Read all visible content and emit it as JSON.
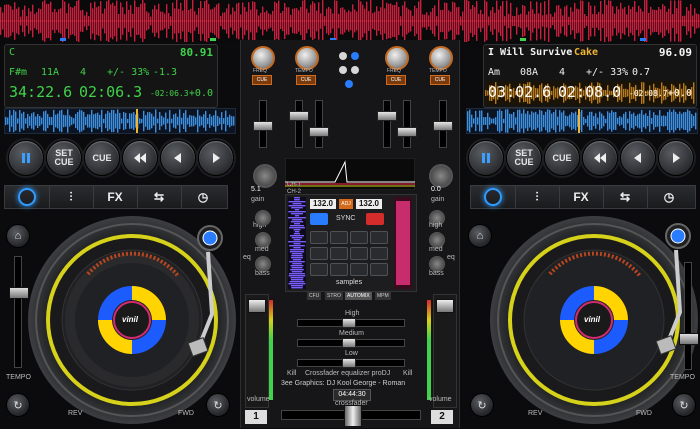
{
  "left_deck": {
    "key": "C",
    "bpm": "80.91",
    "key_detail": "F#m",
    "key_code": "11A",
    "beat": "4",
    "pitch_range": "+/- 33%",
    "pitch_value": "-1.3",
    "elapsed": "34:22.6",
    "remaining": "02:06.3",
    "offset": "-02:06.3",
    "pitch_display": "+0.0",
    "gain_value": "5.1",
    "gain_label": "gain",
    "eq_high": "high",
    "eq_med": "med",
    "eq_bass": "bass",
    "eq_label": "eq",
    "deck_number": "1",
    "tempo_label": "TEMPO",
    "rev_label": "REV",
    "fwd_label": "FWD",
    "volume_label": "volume",
    "platter_logo": "vinil"
  },
  "right_deck": {
    "title": "I Will Survive",
    "artist": "Cake",
    "bpm": "96.09",
    "key_detail": "Am",
    "key_code": "08A",
    "beat": "4",
    "pitch_range": "+/- 33%",
    "pitch_value": "0.7",
    "elapsed": "03:02.6",
    "remaining": "02:08.0",
    "offset": "-02:08.7",
    "pitch_display": "+0.0",
    "gain_value": "0.0",
    "gain_label": "gain",
    "eq_high": "high",
    "eq_med": "med",
    "eq_bass": "bass",
    "eq_label": "eq",
    "deck_number": "2",
    "tempo_label": "TEMPO",
    "rev_label": "REV",
    "fwd_label": "FWD",
    "volume_label": "volume",
    "platter_logo": "vinil"
  },
  "transport": {
    "pause": "pause-icon",
    "set_cue": "SET CUE",
    "cue": "CUE",
    "rewind": "rewind-icon",
    "prev": "prev-icon",
    "play": "play-icon"
  },
  "tabs": {
    "fx": "FX"
  },
  "mixer": {
    "knob_labels": [
      "FREQ",
      "TEMPO",
      "FREQ",
      "TEMPO"
    ],
    "cue_label": "CUE",
    "ch1": "CH-1",
    "ch2": "CH-2",
    "bpm_left": "132.0",
    "bpm_right": "132.0",
    "sync_label": "SYNC",
    "adj_label": "ADJ",
    "samples_label": "samples",
    "mini_tabs": [
      "CFU",
      "STRO",
      "AUTOMIX",
      "MPM"
    ],
    "high_label": "High",
    "medium_label": "Medium",
    "low_label": "Low",
    "kill_label": "Kill",
    "crossfader_eq": "Crossfader equalizer proDJ",
    "credits": "3ee Graphics: DJ Kool George - Roman",
    "clock": "04:44:30",
    "crossfader_label": "crossfader"
  },
  "colors": {
    "green": "#3fd24a",
    "amber": "#f0b531",
    "blue": "#2a7cff",
    "orange": "#d46b1c",
    "pink": "#e0347a"
  }
}
